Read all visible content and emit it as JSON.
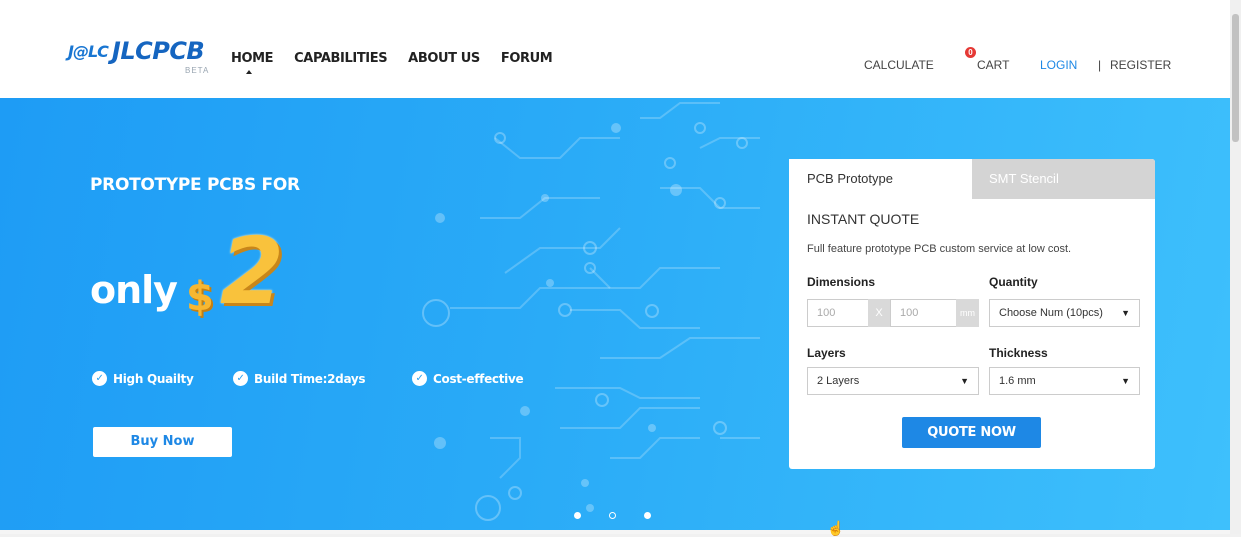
{
  "header": {
    "logo_mark": "J@LC",
    "logo_text": "JLCPCB",
    "logo_badge": "BETA",
    "nav": [
      "HOME",
      "CAPABILITIES",
      "ABOUT US",
      "FORUM"
    ],
    "calculate": "CALCULATE",
    "cart_count": "0",
    "cart": "CART",
    "login": "LOGIN",
    "separator": "|",
    "register": "REGISTER"
  },
  "hero": {
    "heading": "PROTOTYPE PCBS FOR",
    "only": "only",
    "currency": "$",
    "price": "2",
    "features": [
      "High Quailty",
      "Build Time:2days",
      "Cost-effective"
    ],
    "buy_button": "Buy  Now",
    "carousel": {
      "slides": 3,
      "active": [
        1,
        3
      ]
    }
  },
  "quote_panel": {
    "tabs": [
      "PCB Prototype",
      "SMT Stencil"
    ],
    "title": "INSTANT QUOTE",
    "description": "Full feature prototype PCB custom service at low cost.",
    "dimensions_label": "Dimensions",
    "dim_width_placeholder": "100",
    "dim_x": "X",
    "dim_height_placeholder": "100",
    "dim_unit": "mm",
    "quantity_label": "Quantity",
    "quantity_value": "Choose Num (10pcs)",
    "layers_label": "Layers",
    "layers_value": "2 Layers",
    "thickness_label": "Thickness",
    "thickness_value": "1.6 mm",
    "quote_button": "QUOTE NOW"
  },
  "colors": {
    "hero_start": "#1e9cf5",
    "hero_end": "#3ec0fc",
    "accent": "#1e88e5",
    "price_gold": "#f9c23c",
    "badge_red": "#e53935"
  },
  "icons": {
    "check": "check-circle-icon",
    "dropdown": "caret-down-icon",
    "cursor": "hand-pointer-icon"
  }
}
